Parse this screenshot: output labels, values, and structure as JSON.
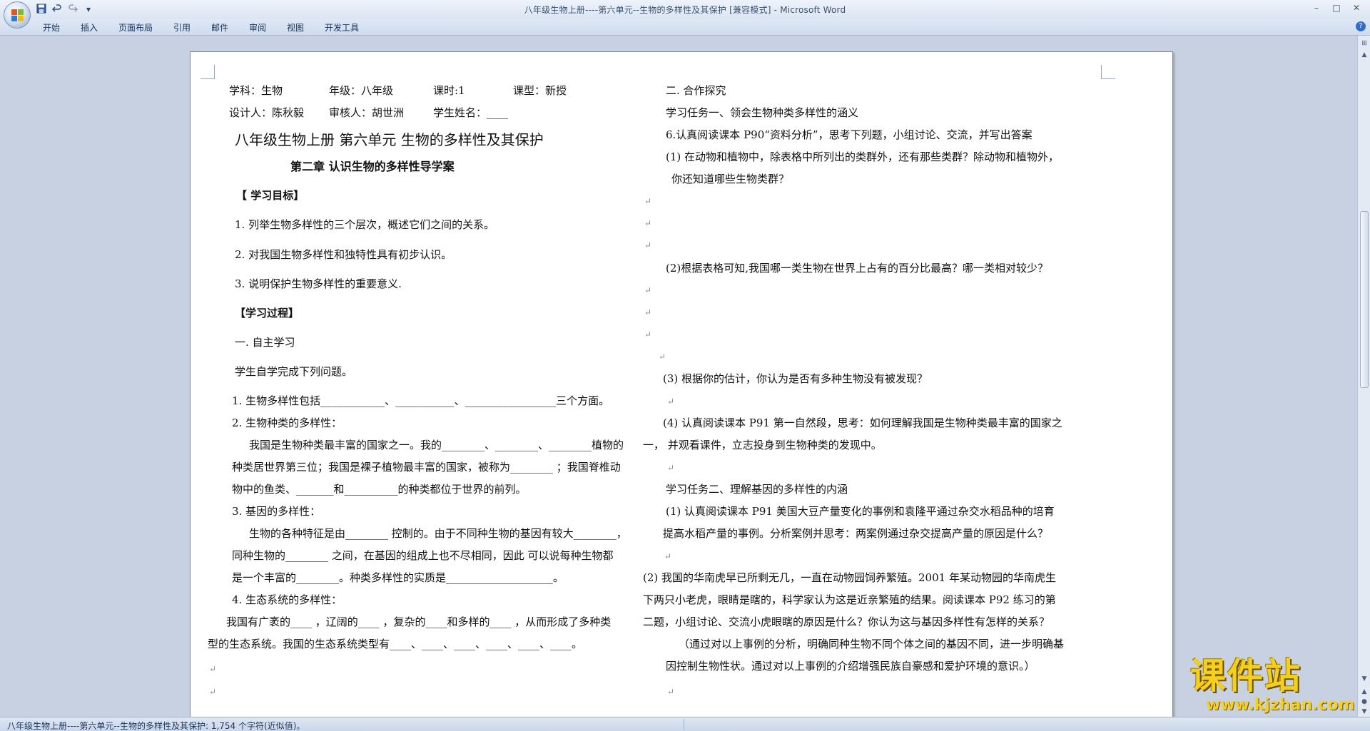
{
  "window": {
    "title": "八年级生物上册----第六单元--生物的多样性及其保护 [兼容模式] - Microsoft Word",
    "controls": {
      "minimize": "–",
      "maximize": "□",
      "close": "✕"
    }
  },
  "ribbon": {
    "tabs": [
      "开始",
      "插入",
      "页面布局",
      "引用",
      "邮件",
      "审阅",
      "视图",
      "开发工具"
    ],
    "help": "?"
  },
  "quick_access": {
    "save": "save-icon",
    "undo": "undo-icon",
    "redo": "redo-icon",
    "more": "▾"
  },
  "document": {
    "left": {
      "l1a": "学科：生物",
      "l1b": "年级：八年级",
      "l1c": "课时:1",
      "l1d": "课型：新授",
      "l2a": "设计人：陈秋毅",
      "l2b": "审核人：胡世洲",
      "l2c": "学生姓名：____",
      "title": "八年级生物上册        第六单元    生物的多样性及其保护",
      "subtitle": "第二章    认识生物的多样性导学案",
      "goals_heading": "【   学习目标】",
      "goal1": "1. 列举生物多样性的三个层次，概述它们之间的关系。",
      "goal2": "2. 对我国生物多样性和独特性具有初步认识。",
      "goal3": "3. 说明保护生物多样性的重要意义.",
      "process_heading": "【学习过程】",
      "self_heading": "一. 自主学习",
      "self_intro": "学生自学完成下列问题。",
      "q1": "1. 生物多样性包括____________、___________、_________________三个方面。",
      "q2": "2. 生物种类的多样性：",
      "q2a": "我国是生物种类最丰富的国家之一。我的________、________、________植物的",
      "q2b": "种类居世界第三位；我国是裸子植物最丰富的国家，被称为________ ；我国脊椎动",
      "q2c": "物中的鱼类、_______和__________的种类都位于世界的前列。",
      "q3": "3. 基因的多样性：",
      "q3a": "生物的各种特征是由________ 控制的。由于不同种生物的基因有较大________，",
      "q3b": "同种生物的________ 之间，在基因的组成上也不尽相同，因此 可以说每种生物都",
      "q3c": "是一个丰富的________。种类多样性的实质是____________________。",
      "q4": "4. 生态系统的多样性：",
      "q4a": "我国有广袤的____ ，辽阔的____ ，复杂的____和多样的____ ，从而形成了多种类",
      "q4b": "型的生态系统。我国的生态系统类型有____、____、____、____、____、____。"
    },
    "right": {
      "h2": "二.   合作探究",
      "task1": "学习任务一、领会生物种类多样性的涵义",
      "r6": "6.认真阅读课本 P90“资料分析”，思考下列题，小组讨论、交流，并写出答案",
      "r1a": "(1) 在动物和植物中，除表格中所列出的类群外，还有那些类群？除动物和植物外，",
      "r1b": "你还知道哪些生物类群？",
      "r2": "(2)根据表格可知,我国哪一类生物在世界上占有的百分比最高？哪一类相对较少？",
      "r3": "(3) 根据你的估计，你认为是否有多种生物没有被发现？",
      "r4a": "(4) 认真阅读课本 P91 第一自然段，思考：如何理解我国是生物种类最丰富的国家之",
      "r4b": "一，  并观看课件，立志投身到生物种类的发现中。",
      "task2": "学习任务二、理解基因的多样性的内涵",
      "t2a": "(1) 认真阅读课本 P91 美国大豆产量变化的事例和袁隆平通过杂交水稻品种的培育",
      "t2b": "提高水稻产量的事例。分析案例并思考：两案例通过杂交提高产量的原因是什么？",
      "t2c": "(2) 我国的华南虎早已所剩无几，一直在动物园饲养繁殖。2001 年某动物园的华南虎生",
      "t2d": "下两只小老虎，眼睛是瞎的，科学家认为这是近亲繁殖的结果。阅读课本 P92 练习的第",
      "t2e": "二题，小组讨论、交流小虎眼瞎的原因是什么？你认为这与基因多样性有怎样的关系？",
      "t2f": "（通过对以上事例的分析，明确同种生物不同个体之间的基因不同，进一步明确基",
      "t2g": "因控制生物性状。通过对以上事例的介绍增强民族自豪感和爱护环境的意识。）"
    },
    "para_mark": "↵"
  },
  "status": {
    "text": "八年级生物上册----第六单元--生物的多样性及其保护: 1,754 个字符(近似值)。"
  },
  "watermark": {
    "main": "课件站",
    "url": "www.kjzhan.com"
  }
}
